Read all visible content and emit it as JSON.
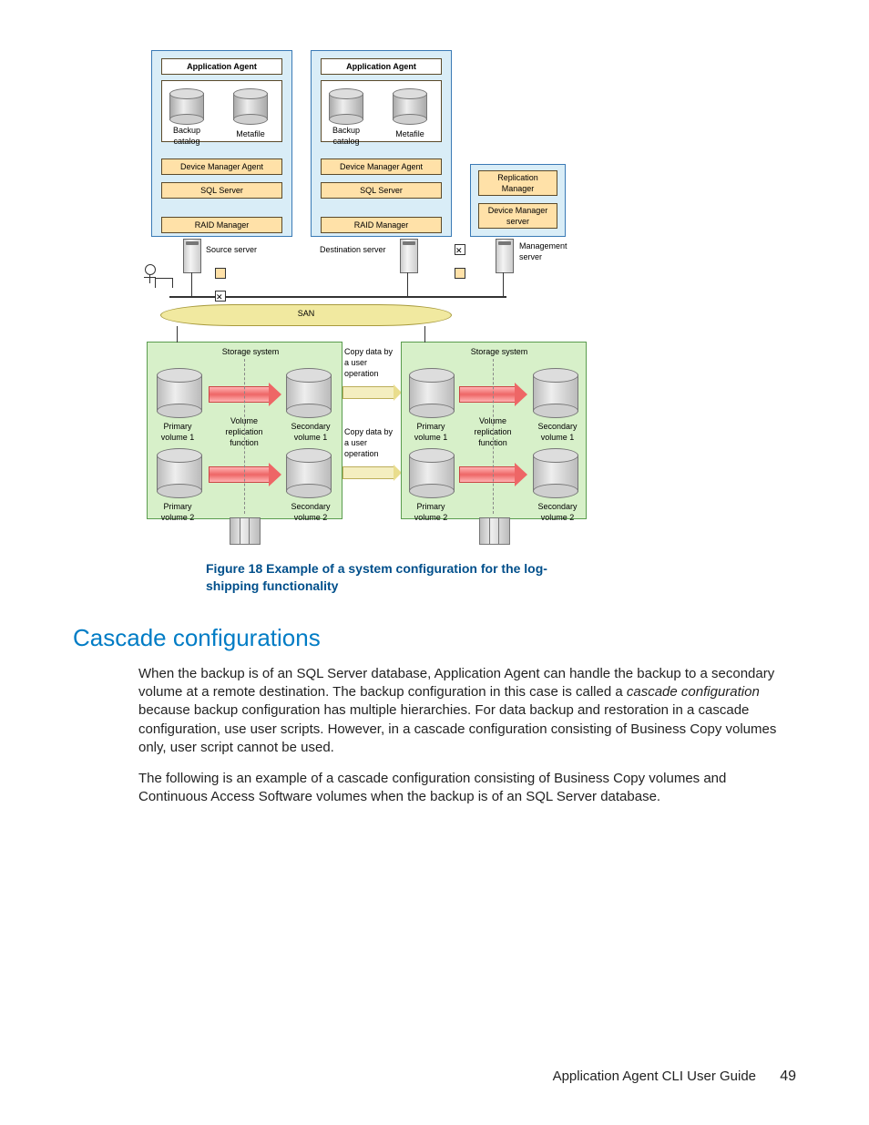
{
  "diagram": {
    "server1": {
      "app_agent": "Application Agent",
      "backup_catalog": "Backup\ncatalog",
      "metafile": "Metafile",
      "dev_mgr": "Device Manager Agent",
      "sql": "SQL Server",
      "raid": "RAID Manager",
      "name": "Source server"
    },
    "server2": {
      "app_agent": "Application Agent",
      "backup_catalog": "Backup\ncatalog",
      "metafile": "Metafile",
      "dev_mgr": "Device Manager Agent",
      "sql": "SQL Server",
      "raid": "RAID Manager",
      "name": "Destination server"
    },
    "mgmt": {
      "rep_mgr": "Replication\nManager",
      "dev_mgr_srv": "Device Manager\nserver",
      "name": "Management\nserver"
    },
    "san": "SAN",
    "storage1": {
      "title": "Storage system",
      "vol_rep": "Volume\nreplication\nfunction",
      "pv1": "Primary\nvolume 1",
      "sv1": "Secondary\nvolume 1",
      "pv2": "Primary\nvolume 2",
      "sv2": "Secondary\nvolume 2"
    },
    "storage2": {
      "title": "Storage system",
      "vol_rep": "Volume\nreplication\nfunction",
      "pv1": "Primary\nvolume 1",
      "sv1": "Secondary\nvolume 1",
      "pv2": "Primary\nvolume 2",
      "sv2": "Secondary\nvolume 2"
    },
    "copy1": "Copy data by\na user\noperation",
    "copy2": "Copy data by\na user\noperation"
  },
  "caption": "Figure 18 Example of a system configuration for the log-shipping functionality",
  "section_title": "Cascade configurations",
  "para1_a": "When the backup is of an SQL Server database, Application Agent can handle the backup to a secondary volume at a remote destination. The backup configuration in this case is called a ",
  "para1_em": "cascade configuration",
  "para1_b": " because backup configuration has multiple hierarchies. For data backup and restoration in a cascade configuration, use user scripts. However, in a cascade configuration consisting of Business Copy volumes only, user script cannot be used.",
  "para2": "The following is an example of a cascade configuration consisting of Business Copy volumes and Continuous Access Software volumes when the backup is of an SQL Server database.",
  "footer_text": "Application Agent CLI User Guide",
  "page_num": "49"
}
